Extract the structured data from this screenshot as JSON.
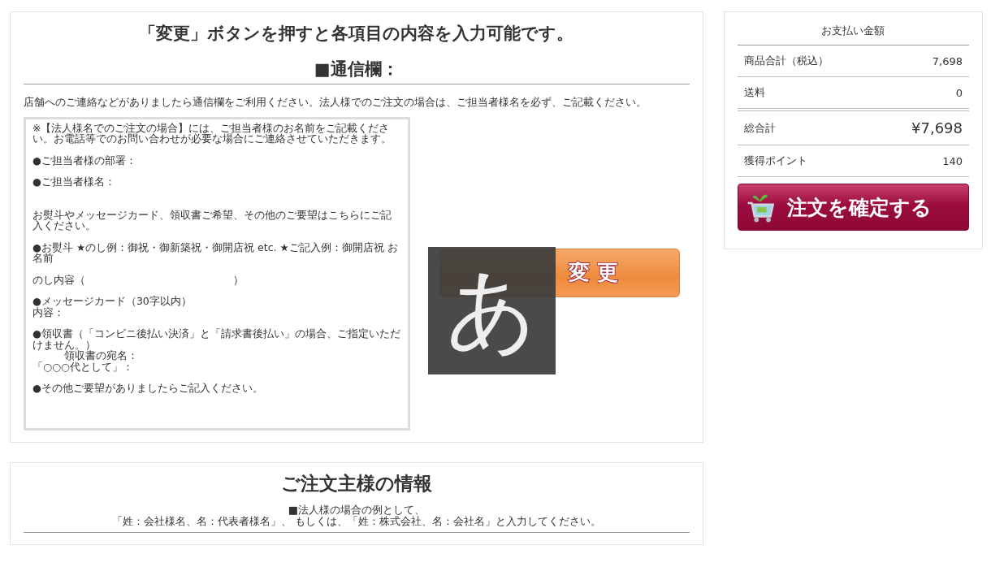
{
  "notice": {
    "heading": "「変更」ボタンを押すと各項目の内容を入力可能です。",
    "section_title": "■通信欄：",
    "description": "店舗へのご連絡などがありましたら通信欄をご利用ください。法人様でのご注文の場合は、ご担当者様名を必ず、ご記載ください。",
    "message_field": {
      "paragraphs": [
        [
          "※【法人様名でのご注文の場合】には、ご担当者様のお名前をご記載ください。お電話等でのお問い合わせが必要な場合にご連絡させていただきます。"
        ],
        [
          "●ご担当者様の部署："
        ],
        [
          "●ご担当者様名："
        ],
        [
          "お熨斗やメッセージカード、領収書ご希望、その他のご要望はこちらにご記入ください。"
        ],
        [
          "●お熨斗 ★のし例：御祝・御新築祝・御開店祝 etc. ★ご記入例：御開店祝 お名前"
        ],
        [
          "のし内容（　　　　　　　　　　　　　　）"
        ],
        [
          "●メッセージカード（30字以内）",
          "内容："
        ],
        [
          "●領収書（「コンビニ後払い決済」と「請求書後払い」の場合、ご指定いただけません。）",
          "　　　領収書の宛名：",
          "「○○○代として」："
        ],
        [
          "●その他ご要望がありましたらご記入ください。"
        ]
      ]
    },
    "change_button": "変 更",
    "ime_indicator": "あ"
  },
  "customer": {
    "title": "ご注文主様の情報",
    "note_lines": [
      "■法人様の場合の例として、",
      "「姓：会社様名、名：代表者様名」、 もしくは、「姓：株式会社、名：会社名」と入力してください。"
    ]
  },
  "payment": {
    "title": "お支払い金額",
    "rows": [
      {
        "kind": "normal",
        "label": "商品合計（税込）",
        "value": "7,698"
      },
      {
        "kind": "normal",
        "label": "送料",
        "value": "0"
      },
      {
        "kind": "total",
        "label": "総合計",
        "value": "¥7,698"
      },
      {
        "kind": "normal",
        "label": "獲得ポイント",
        "value": "140"
      }
    ],
    "confirm_button": "注文を確定する"
  }
}
